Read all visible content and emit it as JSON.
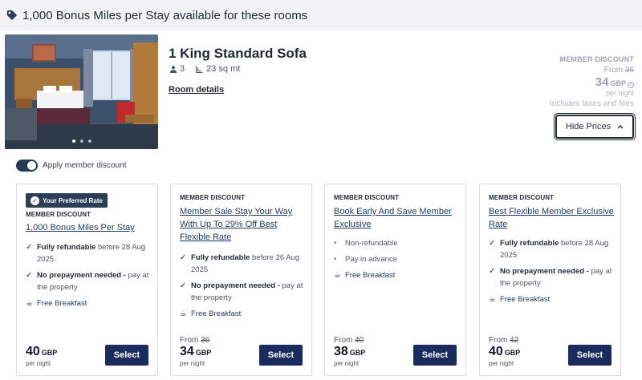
{
  "banner": {
    "text": "1,000 Bonus Miles per Stay available for these rooms",
    "icon": "tag-icon"
  },
  "room": {
    "title": "1 King Standard Sofa",
    "guests": "3",
    "size": "23 sq mt",
    "details_link": "Room details",
    "carousel": {
      "slides": 3,
      "active": 1
    }
  },
  "price_summary": {
    "label": "MEMBER DISCOUNT",
    "from_prefix": "From",
    "from_price": "36",
    "price": "34",
    "currency": "GBP",
    "per_night": "per night",
    "tax_note": "Includes taxes and fees",
    "hide_button": "Hide Prices"
  },
  "toggle": {
    "label": "Apply member discount",
    "on": true
  },
  "cards": [
    {
      "badge": "Your Preferred Rate",
      "label": "MEMBER DISCOUNT",
      "name": "1,000 Bonus Miles Per Stay",
      "f1_bold": "Fully refundable",
      "f1_rest": " before 28 Aug 2025",
      "f2_bold": "No prepayment needed -",
      "f2_rest": " pay at the property",
      "breakfast": "Free Breakfast",
      "price": "40",
      "currency": "GBP",
      "per_night": "per night",
      "select": "Select"
    },
    {
      "label": "MEMBER DISCOUNT",
      "name": "Member Sale Stay Your Way With Up To 29% Off Best Flexible Rate",
      "f1_bold": "Fully refundable",
      "f1_rest": " before 26 Aug 2025",
      "f2_bold": "No prepayment needed -",
      "f2_rest": " pay at the property",
      "breakfast": "Free Breakfast",
      "from_prefix": "From",
      "from_price": "36",
      "price": "34",
      "currency": "GBP",
      "per_night": "per night",
      "select": "Select"
    },
    {
      "label": "MEMBER DISCOUNT",
      "name": "Book Early And Save Member Exclusive",
      "b1": "Non-refundable",
      "b2": "Pay in advance",
      "breakfast": "Free Breakfast",
      "from_prefix": "From",
      "from_price": "40",
      "price": "38",
      "currency": "GBP",
      "per_night": "per night",
      "select": "Select"
    },
    {
      "label": "MEMBER DISCOUNT",
      "name": "Best Flexible Member Exclusive Rate",
      "f1_bold": "Fully refundable",
      "f1_rest": " before 28 Aug 2025",
      "f2_bold": "No prepayment needed -",
      "f2_rest": " pay at the property",
      "breakfast": "Free Breakfast",
      "from_prefix": "From",
      "from_price": "42",
      "price": "40",
      "currency": "GBP",
      "per_night": "per night",
      "select": "Select"
    }
  ],
  "colors": {
    "select_button": "#1a2b5e",
    "banner_bg": "#f1f2f4",
    "link": "#1f3a5f"
  }
}
